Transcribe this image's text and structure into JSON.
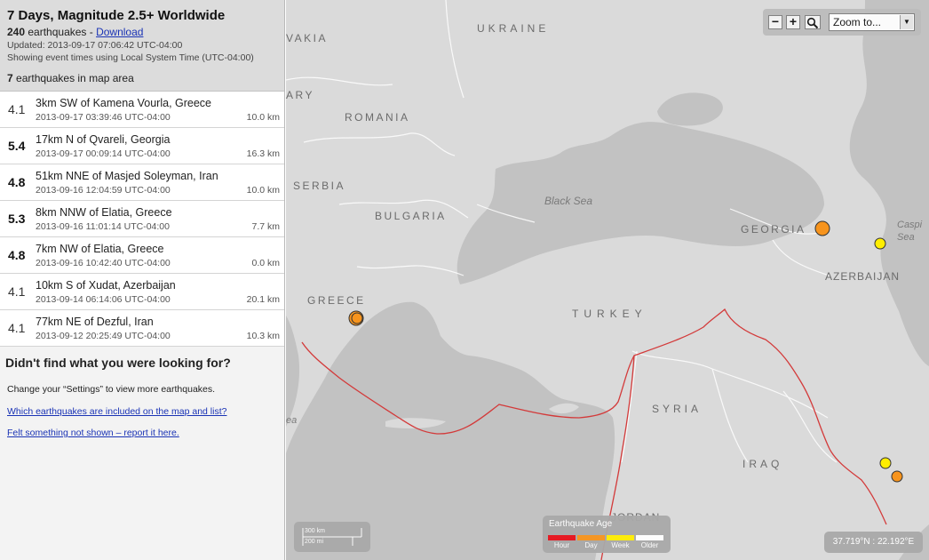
{
  "feed": {
    "title": "7 Days, Magnitude 2.5+ Worldwide",
    "count_number": "240",
    "count_text": " earthquakes - ",
    "download_label": "Download",
    "updated": "Updated: 2013-09-17 07:06:42 UTC-04:00",
    "timezone_note": "Showing event times using Local System Time (UTC-04:00)",
    "in_area_number": "7",
    "in_area_text": " earthquakes in map area"
  },
  "earthquakes": [
    {
      "mag": "4.1",
      "place": "3km SW of Kamena Vourla, Greece",
      "time": "2013-09-17 03:39:46 UTC-04:00",
      "depth": "10.0 km"
    },
    {
      "mag": "5.4",
      "place": "17km N of Qvareli, Georgia",
      "time": "2013-09-17 00:09:14 UTC-04:00",
      "depth": "16.3 km"
    },
    {
      "mag": "4.8",
      "place": "51km NNE of Masjed Soleyman, Iran",
      "time": "2013-09-16 12:04:59 UTC-04:00",
      "depth": "10.0 km"
    },
    {
      "mag": "5.3",
      "place": "8km NNW of Elatia, Greece",
      "time": "2013-09-16 11:01:14 UTC-04:00",
      "depth": "7.7 km"
    },
    {
      "mag": "4.8",
      "place": "7km NW of Elatia, Greece",
      "time": "2013-09-16 10:42:40 UTC-04:00",
      "depth": "0.0 km"
    },
    {
      "mag": "4.1",
      "place": "10km S of Xudat, Azerbaijan",
      "time": "2013-09-14 06:14:06 UTC-04:00",
      "depth": "20.1 km"
    },
    {
      "mag": "4.1",
      "place": "77km NE of Dezful, Iran",
      "time": "2013-09-12 20:25:49 UTC-04:00",
      "depth": "10.3 km"
    }
  ],
  "help": {
    "title": "Didn't find what you were looking for?",
    "settings_text": "Change your “Settings” to view more earthquakes.",
    "link_included": "Which earthquakes are included on the map and list?",
    "link_report": "Felt something not shown – report it here."
  },
  "map": {
    "labels": {
      "vakia": "VAKIA",
      "ukraine": "UKRAINE",
      "ary": "ARY",
      "romania": "ROMANIA",
      "serbia": "SERBIA",
      "bulgaria": "BULGARIA",
      "georgia": "GEORGIA",
      "azerbaijan": "AZERBAIJAN",
      "greece": "GREECE",
      "turkey": "TURKEY",
      "syria": "SYRIA",
      "iraq": "IRAQ",
      "jordan": "JORDAN",
      "black_sea": "Black Sea",
      "caspian_1": "Caspi",
      "caspian_2": "Sea",
      "ea": "ea"
    },
    "zoom": {
      "minus": "−",
      "plus": "+",
      "select_label": "Zoom to...",
      "arrow": "▼"
    },
    "scale": {
      "km": "300 km",
      "mi": "200 mi"
    },
    "legend": {
      "title": "Earthquake Age",
      "items": [
        {
          "label": "Hour",
          "color": "#e8121b"
        },
        {
          "label": "Day",
          "color": "#f7941d"
        },
        {
          "label": "Week",
          "color": "#ffee00"
        },
        {
          "label": "Older",
          "color": "#ffffff"
        }
      ]
    },
    "coordinates": "37.719°N : 22.192°E",
    "colors": {
      "land": "#dadada",
      "water": "#c2c2c2",
      "plate_boundary": "#d33a3a",
      "day_marker": "#f7941d",
      "week_marker": "#ffee00"
    }
  }
}
